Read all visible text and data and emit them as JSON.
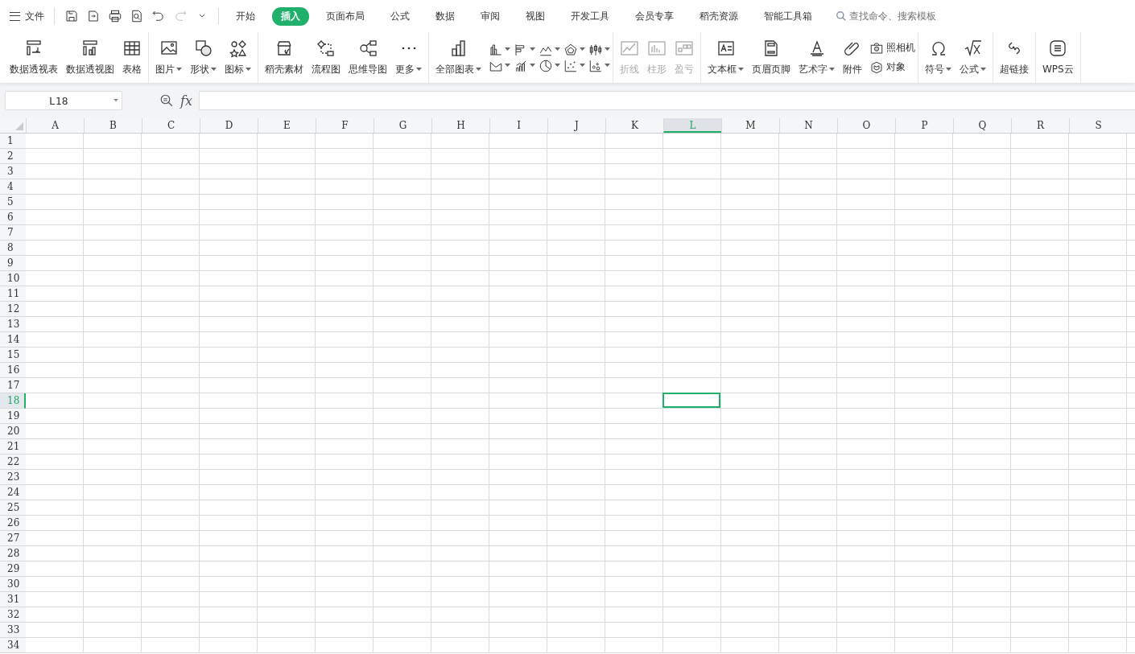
{
  "menu": {
    "file": "文件",
    "tabs": [
      {
        "label": "开始",
        "selected": false
      },
      {
        "label": "插入",
        "selected": true
      },
      {
        "label": "页面布局",
        "selected": false
      },
      {
        "label": "公式",
        "selected": false
      },
      {
        "label": "数据",
        "selected": false
      },
      {
        "label": "审阅",
        "selected": false
      },
      {
        "label": "视图",
        "selected": false
      },
      {
        "label": "开发工具",
        "selected": false
      },
      {
        "label": "会员专享",
        "selected": false
      },
      {
        "label": "稻壳资源",
        "selected": false
      },
      {
        "label": "智能工具箱",
        "selected": false
      }
    ],
    "search": {
      "placeholder": "查找命令、搜索模板"
    }
  },
  "ribbon": {
    "groups": [
      {
        "items": [
          {
            "kind": "large",
            "label": "数据透视表",
            "dropdown": false,
            "disabled": false
          },
          {
            "kind": "large",
            "label": "数据透视图",
            "dropdown": false,
            "disabled": false
          },
          {
            "kind": "large",
            "label": "表格",
            "dropdown": false,
            "disabled": false
          }
        ]
      },
      {
        "items": [
          {
            "kind": "large",
            "label": "图片",
            "dropdown": true,
            "disabled": false
          },
          {
            "kind": "large",
            "label": "形状",
            "dropdown": true,
            "disabled": false
          },
          {
            "kind": "large",
            "label": "图标",
            "dropdown": true,
            "disabled": false
          }
        ]
      },
      {
        "items": [
          {
            "kind": "large",
            "label": "稻壳素材",
            "dropdown": false,
            "disabled": false
          },
          {
            "kind": "large",
            "label": "流程图",
            "dropdown": false,
            "disabled": false
          },
          {
            "kind": "large",
            "label": "思维导图",
            "dropdown": false,
            "disabled": false
          },
          {
            "kind": "large",
            "label": "更多",
            "dropdown": true,
            "disabled": false
          }
        ]
      },
      {
        "items": [
          {
            "kind": "large",
            "label": "全部图表",
            "dropdown": true,
            "disabled": false
          },
          {
            "kind": "charts"
          }
        ]
      },
      {
        "items": [
          {
            "kind": "large",
            "label": "折线",
            "dropdown": false,
            "disabled": true
          },
          {
            "kind": "large",
            "label": "柱形",
            "dropdown": false,
            "disabled": true
          },
          {
            "kind": "large",
            "label": "盈亏",
            "dropdown": false,
            "disabled": true
          }
        ]
      },
      {
        "items": [
          {
            "kind": "large",
            "label": "文本框",
            "dropdown": true,
            "disabled": false
          },
          {
            "kind": "large",
            "label": "页眉页脚",
            "dropdown": false,
            "disabled": false
          },
          {
            "kind": "large",
            "label": "艺术字",
            "dropdown": true,
            "disabled": false
          },
          {
            "kind": "large",
            "label": "附件",
            "dropdown": false,
            "disabled": false
          },
          {
            "kind": "small",
            "labels": [
              "照相机",
              "对象"
            ]
          }
        ]
      },
      {
        "items": [
          {
            "kind": "large",
            "label": "符号",
            "dropdown": true,
            "disabled": false
          },
          {
            "kind": "large",
            "label": "公式",
            "dropdown": true,
            "disabled": false
          }
        ]
      },
      {
        "items": [
          {
            "kind": "large",
            "label": "超链接",
            "dropdown": false,
            "disabled": false
          }
        ]
      },
      {
        "items": [
          {
            "kind": "large",
            "label": "WPS云",
            "dropdown": false,
            "disabled": false
          }
        ]
      }
    ]
  },
  "formula_bar": {
    "name_box": "L18",
    "fx": "fx"
  },
  "sheet": {
    "columns": [
      {
        "label": "A",
        "selected": false
      },
      {
        "label": "B",
        "selected": false
      },
      {
        "label": "C",
        "selected": false
      },
      {
        "label": "D",
        "selected": false
      },
      {
        "label": "E",
        "selected": false
      },
      {
        "label": "F",
        "selected": false
      },
      {
        "label": "G",
        "selected": false
      },
      {
        "label": "H",
        "selected": false
      },
      {
        "label": "I",
        "selected": false
      },
      {
        "label": "J",
        "selected": false
      },
      {
        "label": "K",
        "selected": false
      },
      {
        "label": "L",
        "selected": true
      },
      {
        "label": "M",
        "selected": false
      },
      {
        "label": "N",
        "selected": false
      },
      {
        "label": "O",
        "selected": false
      },
      {
        "label": "P",
        "selected": false
      },
      {
        "label": "Q",
        "selected": false
      },
      {
        "label": "R",
        "selected": false
      },
      {
        "label": "S",
        "selected": false
      }
    ],
    "rows": [
      {
        "label": "1",
        "selected": false
      },
      {
        "label": "2",
        "selected": false
      },
      {
        "label": "3",
        "selected": false
      },
      {
        "label": "4",
        "selected": false
      },
      {
        "label": "5",
        "selected": false
      },
      {
        "label": "6",
        "selected": false
      },
      {
        "label": "7",
        "selected": false
      },
      {
        "label": "8",
        "selected": false
      },
      {
        "label": "9",
        "selected": false
      },
      {
        "label": "10",
        "selected": false
      },
      {
        "label": "11",
        "selected": false
      },
      {
        "label": "12",
        "selected": false
      },
      {
        "label": "13",
        "selected": false
      },
      {
        "label": "14",
        "selected": false
      },
      {
        "label": "15",
        "selected": false
      },
      {
        "label": "16",
        "selected": false
      },
      {
        "label": "17",
        "selected": false
      },
      {
        "label": "18",
        "selected": true
      },
      {
        "label": "19",
        "selected": false
      },
      {
        "label": "20",
        "selected": false
      },
      {
        "label": "21",
        "selected": false
      },
      {
        "label": "22",
        "selected": false
      },
      {
        "label": "23",
        "selected": false
      },
      {
        "label": "24",
        "selected": false
      },
      {
        "label": "25",
        "selected": false
      },
      {
        "label": "26",
        "selected": false
      },
      {
        "label": "27",
        "selected": false
      },
      {
        "label": "28",
        "selected": false
      },
      {
        "label": "29",
        "selected": false
      },
      {
        "label": "30",
        "selected": false
      },
      {
        "label": "31",
        "selected": false
      },
      {
        "label": "32",
        "selected": false
      },
      {
        "label": "33",
        "selected": false
      },
      {
        "label": "34",
        "selected": false
      }
    ]
  }
}
